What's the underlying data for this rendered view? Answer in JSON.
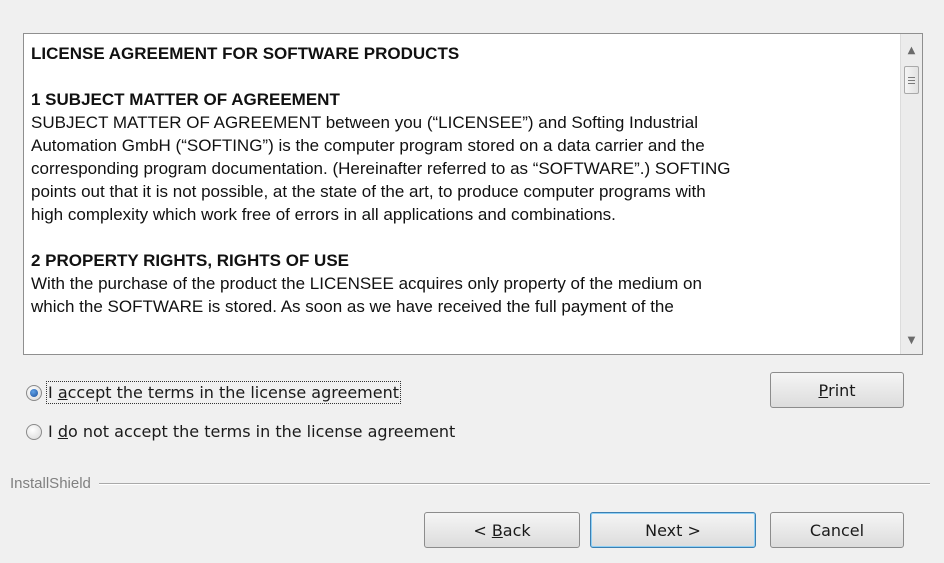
{
  "license": {
    "title": "LICENSE AGREEMENT FOR SOFTWARE PRODUCTS",
    "section1_heading": "1 SUBJECT MATTER OF AGREEMENT",
    "section1_lines": [
      "SUBJECT MATTER OF AGREEMENT between you (“LICENSEE”) and Softing Industrial",
      "Automation GmbH (“SOFTING”) is the computer program stored on a data carrier and the",
      "corresponding program documentation. (Hereinafter referred to as “SOFTWARE”.) SOFTING",
      "points out that it is not possible, at the state of the art, to produce computer programs with",
      "high complexity which work free of errors in all applications and combinations."
    ],
    "section2_heading": "2 PROPERTY RIGHTS, RIGHTS OF USE",
    "section2_lines": [
      "With the purchase of the product the LICENSEE acquires only property of the medium on",
      "which the SOFTWARE is stored. As soon as we have received the full payment of the"
    ]
  },
  "options": {
    "accept": {
      "pre": "I ",
      "accel": "a",
      "post": "ccept the terms in the license agreement",
      "selected": true
    },
    "decline": {
      "pre": "I ",
      "accel": "d",
      "post": "o not accept the terms in the license agreement",
      "selected": false
    }
  },
  "buttons": {
    "print": {
      "accel": "P",
      "rest": "rint"
    },
    "back": {
      "pre": "< ",
      "accel": "B",
      "rest": "ack"
    },
    "next": "Next >",
    "cancel": "Cancel"
  },
  "brand": "InstallShield",
  "icons": {
    "scroll_up": "scroll-up-arrow-icon",
    "scroll_down": "scroll-down-arrow-icon",
    "scroll_thumb": "scroll-thumb-grip-icon"
  }
}
